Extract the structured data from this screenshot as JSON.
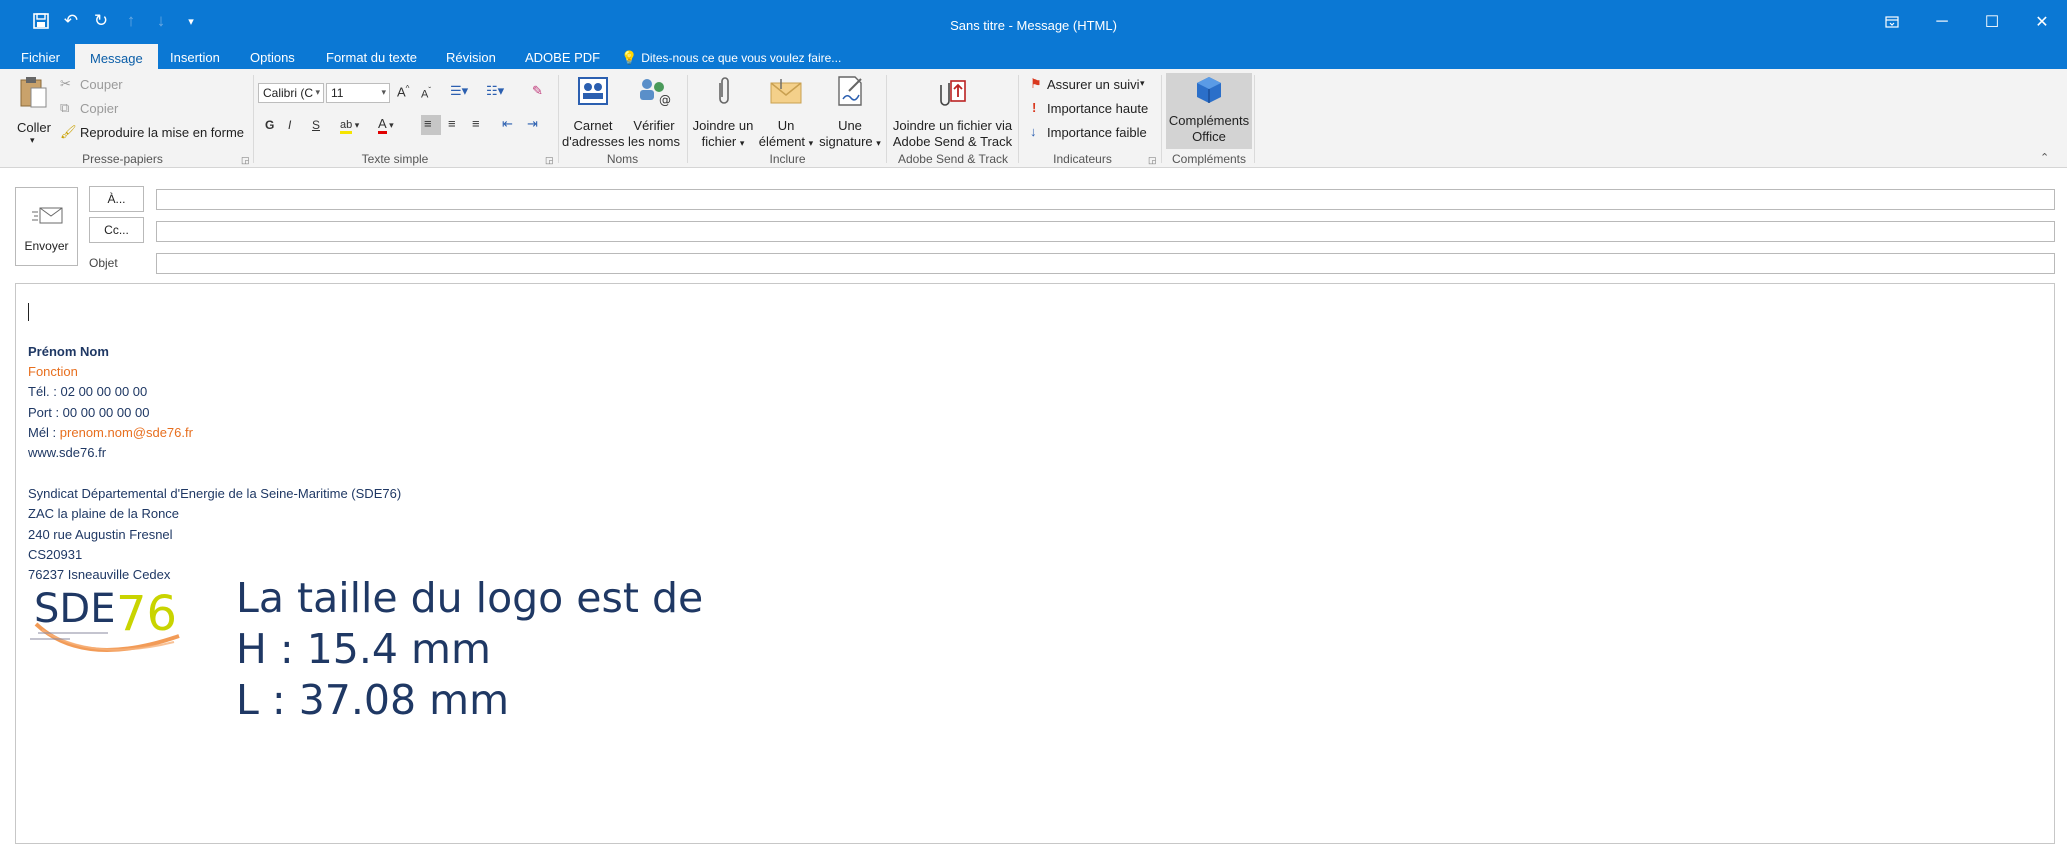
{
  "window": {
    "title": "Sans titre - Message (HTML)"
  },
  "tabs": [
    "Fichier",
    "Message",
    "Insertion",
    "Options",
    "Format du texte",
    "Révision",
    "ADOBE PDF"
  ],
  "tell_me": "Dites-nous ce que vous voulez faire...",
  "ribbon": {
    "clipboard": {
      "paste": "Coller",
      "cut": "Couper",
      "copy": "Copier",
      "format_painter": "Reproduire la mise en forme",
      "group": "Presse-papiers"
    },
    "basic_text": {
      "font": "Calibri (C",
      "size": "11",
      "bold": "G",
      "italic": "I",
      "underline": "S",
      "group": "Texte simple"
    },
    "names": {
      "address_book_1": "Carnet",
      "address_book_2": "d'adresses",
      "check_names_1": "Vérifier",
      "check_names_2": "les noms",
      "group": "Noms"
    },
    "include": {
      "attach_file_1": "Joindre un",
      "attach_file_2": "fichier",
      "attach_item_1": "Un",
      "attach_item_2": "élément",
      "signature_1": "Une",
      "signature_2": "signature",
      "group": "Inclure"
    },
    "adobe": {
      "label_1": "Joindre un fichier via",
      "label_2": "Adobe Send & Track",
      "group": "Adobe Send & Track"
    },
    "tags": {
      "follow_up": "Assurer un suivi",
      "high": "Importance haute",
      "low": "Importance faible",
      "group": "Indicateurs"
    },
    "addins": {
      "label_1": "Compléments",
      "label_2": "Office",
      "group": "Compléments"
    }
  },
  "header": {
    "send": "Envoyer",
    "to": "À...",
    "cc": "Cc...",
    "subject": "Objet"
  },
  "signature": {
    "name": "Prénom Nom",
    "function": "Fonction",
    "tel": "Tél. : 02 00 00 00 00",
    "port": "Port : 00 00 00 00 00",
    "mel_label": "Mél : ",
    "mel_value": "prenom.nom@sde76.fr",
    "web": "www.sde76.fr",
    "org": "Syndicat Départemental d'Energie de la Seine-Maritime (SDE76)",
    "addr1": "ZAC la plaine de la Ronce",
    "addr2": "240 rue Augustin Fresnel",
    "addr3": "CS20931",
    "addr4": "76237 Isneauville Cedex"
  },
  "logo": {
    "text_a": "SDE",
    "text_b": "76"
  },
  "note": {
    "line1": "La taille du logo est de",
    "line2": "H : 15.4 mm",
    "line3": "L : 37.08 mm"
  }
}
